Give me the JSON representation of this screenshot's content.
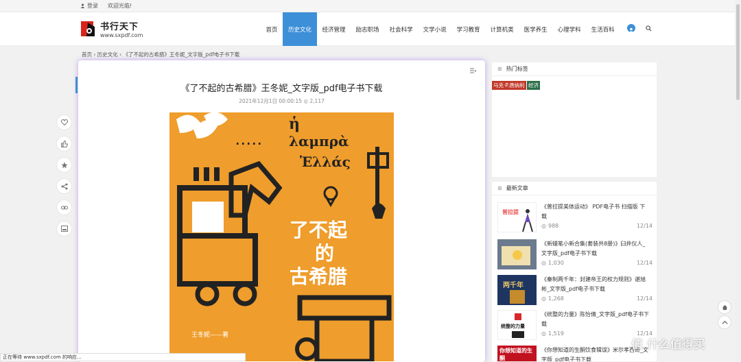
{
  "topbar": {
    "login": "登录",
    "welcome": "欢迎光临!"
  },
  "logo": {
    "name": "书行天下",
    "url": "www.sxpdf.com"
  },
  "nav": [
    "首页",
    "历史文化",
    "经济管理",
    "励志职场",
    "社会科学",
    "文学小说",
    "学习教育",
    "计算机类",
    "医学养生",
    "心理学科",
    "生活百科"
  ],
  "breadcrumb": {
    "home": "首页",
    "cat": "历史文化",
    "current": "《了不起的古希腊》王冬妮_文字版_pdf电子书下载"
  },
  "article": {
    "title": "《了不起的古希腊》王冬妮_文字版_pdf电子书下载",
    "date": "2021年12月1日 00:00:15",
    "views": "2,117"
  },
  "cover": {
    "greek1": "ἡ",
    "greek2": "λαμπρὰ",
    "greek3": "Ἑλλάς",
    "cn1": "了不起",
    "cn2": "的",
    "cn3": "古希腊",
    "author": "王冬妮——著"
  },
  "sidebar": {
    "tags_title": "热门标签",
    "tag1": "马克·P.唐纳利",
    "tag2": "经济",
    "recent_title": "最新文章",
    "articles": [
      {
        "title": "《普拉提美体运动》 PDF电子书 扫描版 下载",
        "views": "988",
        "date": "12/14",
        "thumb": "普拉提"
      },
      {
        "title": "《新蜡笔小新合集(套装共8册)》臼井仪人_文字版_pdf电子书下载",
        "views": "1,030",
        "date": "12/14",
        "thumb": ""
      },
      {
        "title": "《秦制两千年：封建帝王的权力规则》谌旭彬_文字版_pdf电子书下载",
        "views": "1,268",
        "date": "12/14",
        "thumb": "两千年"
      },
      {
        "title": "《统整的力量》陈怡倩_文字版_pdf电子书下载",
        "views": "1,519",
        "date": "12/14",
        "thumb": "统整的力量"
      },
      {
        "title": "《你想知道的生酮饮食辑误》米尔孝西奇_文字版_pdf电子书下载",
        "views": "",
        "date": "",
        "thumb": "你想知道的生酮"
      }
    ]
  },
  "status": "正在等待 www.sxpdf.com 的响应...",
  "watermark": "值 什么值得买",
  "colors": {
    "accent": "#3d8fd8",
    "cover": "#ef9d2c",
    "tag1": "#c0392b",
    "tag2": "#2c6e49"
  }
}
